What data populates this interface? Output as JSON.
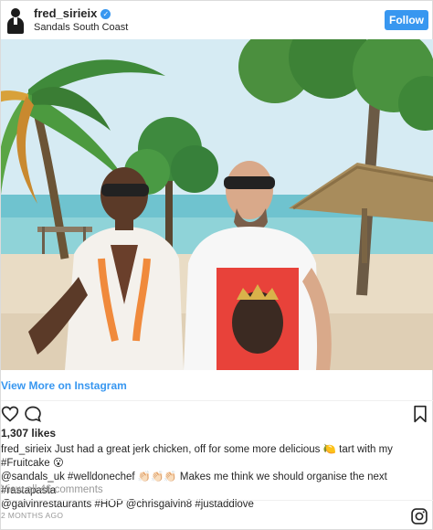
{
  "header": {
    "username": "fred_sirieix",
    "verified_mark": "✓",
    "location": "Sandals South Coast",
    "follow_label": "Follow"
  },
  "photo": {
    "shirt_caption": "",
    "icons": [
      "palm-tree",
      "thatched-hut",
      "tree"
    ]
  },
  "view_more_label": "View More on Instagram",
  "actions": {
    "icons": [
      "heart-icon",
      "comment-icon",
      "bookmark-icon"
    ]
  },
  "likes": "1,307 likes",
  "caption": {
    "username": "fred_sirieix",
    "line1": "Just had a great jerk chicken, off for some more delicious 🍋 tart with my #Fruitcake 😮",
    "line2": "@sandals_uk #welldonechef 👏🏻👏🏻👏🏻 Makes me think we should organise the next #rastapasta",
    "line3": "@galvinrestaurants #HOP @chrisgalvin8 #justaddlove"
  },
  "view_comments": "View all 46 comments",
  "timestamp": "2 MONTHS AGO",
  "colors": {
    "accent": "#3897f0",
    "text": "#262626",
    "muted": "#999999"
  }
}
